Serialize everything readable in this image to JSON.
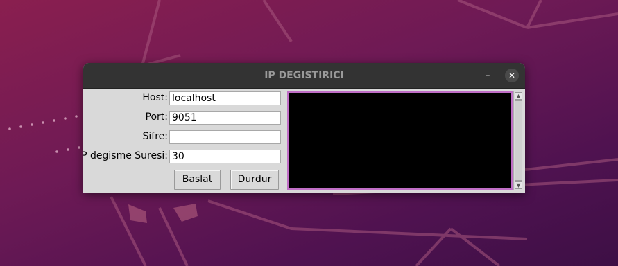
{
  "window": {
    "title": "IP DEGISTIRICI",
    "minimize_glyph": "–",
    "close_glyph": "✕"
  },
  "form": {
    "host_label": "Host:",
    "host_value": "localhost",
    "port_label": "Port:",
    "port_value": "9051",
    "password_label": "Sifre:",
    "password_value": "",
    "interval_label": "IP degisme Suresi:",
    "interval_value": "30"
  },
  "buttons": {
    "start_label": "Baslat",
    "stop_label": "Durdur"
  },
  "scrollbar": {
    "up_glyph": "▲",
    "down_glyph": "▼"
  },
  "colors": {
    "titlebar": "#333333",
    "window_bg": "#d9d9d9",
    "output_bg": "#000000",
    "output_border": "#c06ec6",
    "wallpaper_accent": "#8a1f4f"
  },
  "icons": [
    "minimize-icon",
    "close-icon",
    "scroll-up-arrow-icon",
    "scroll-down-arrow-icon"
  ]
}
